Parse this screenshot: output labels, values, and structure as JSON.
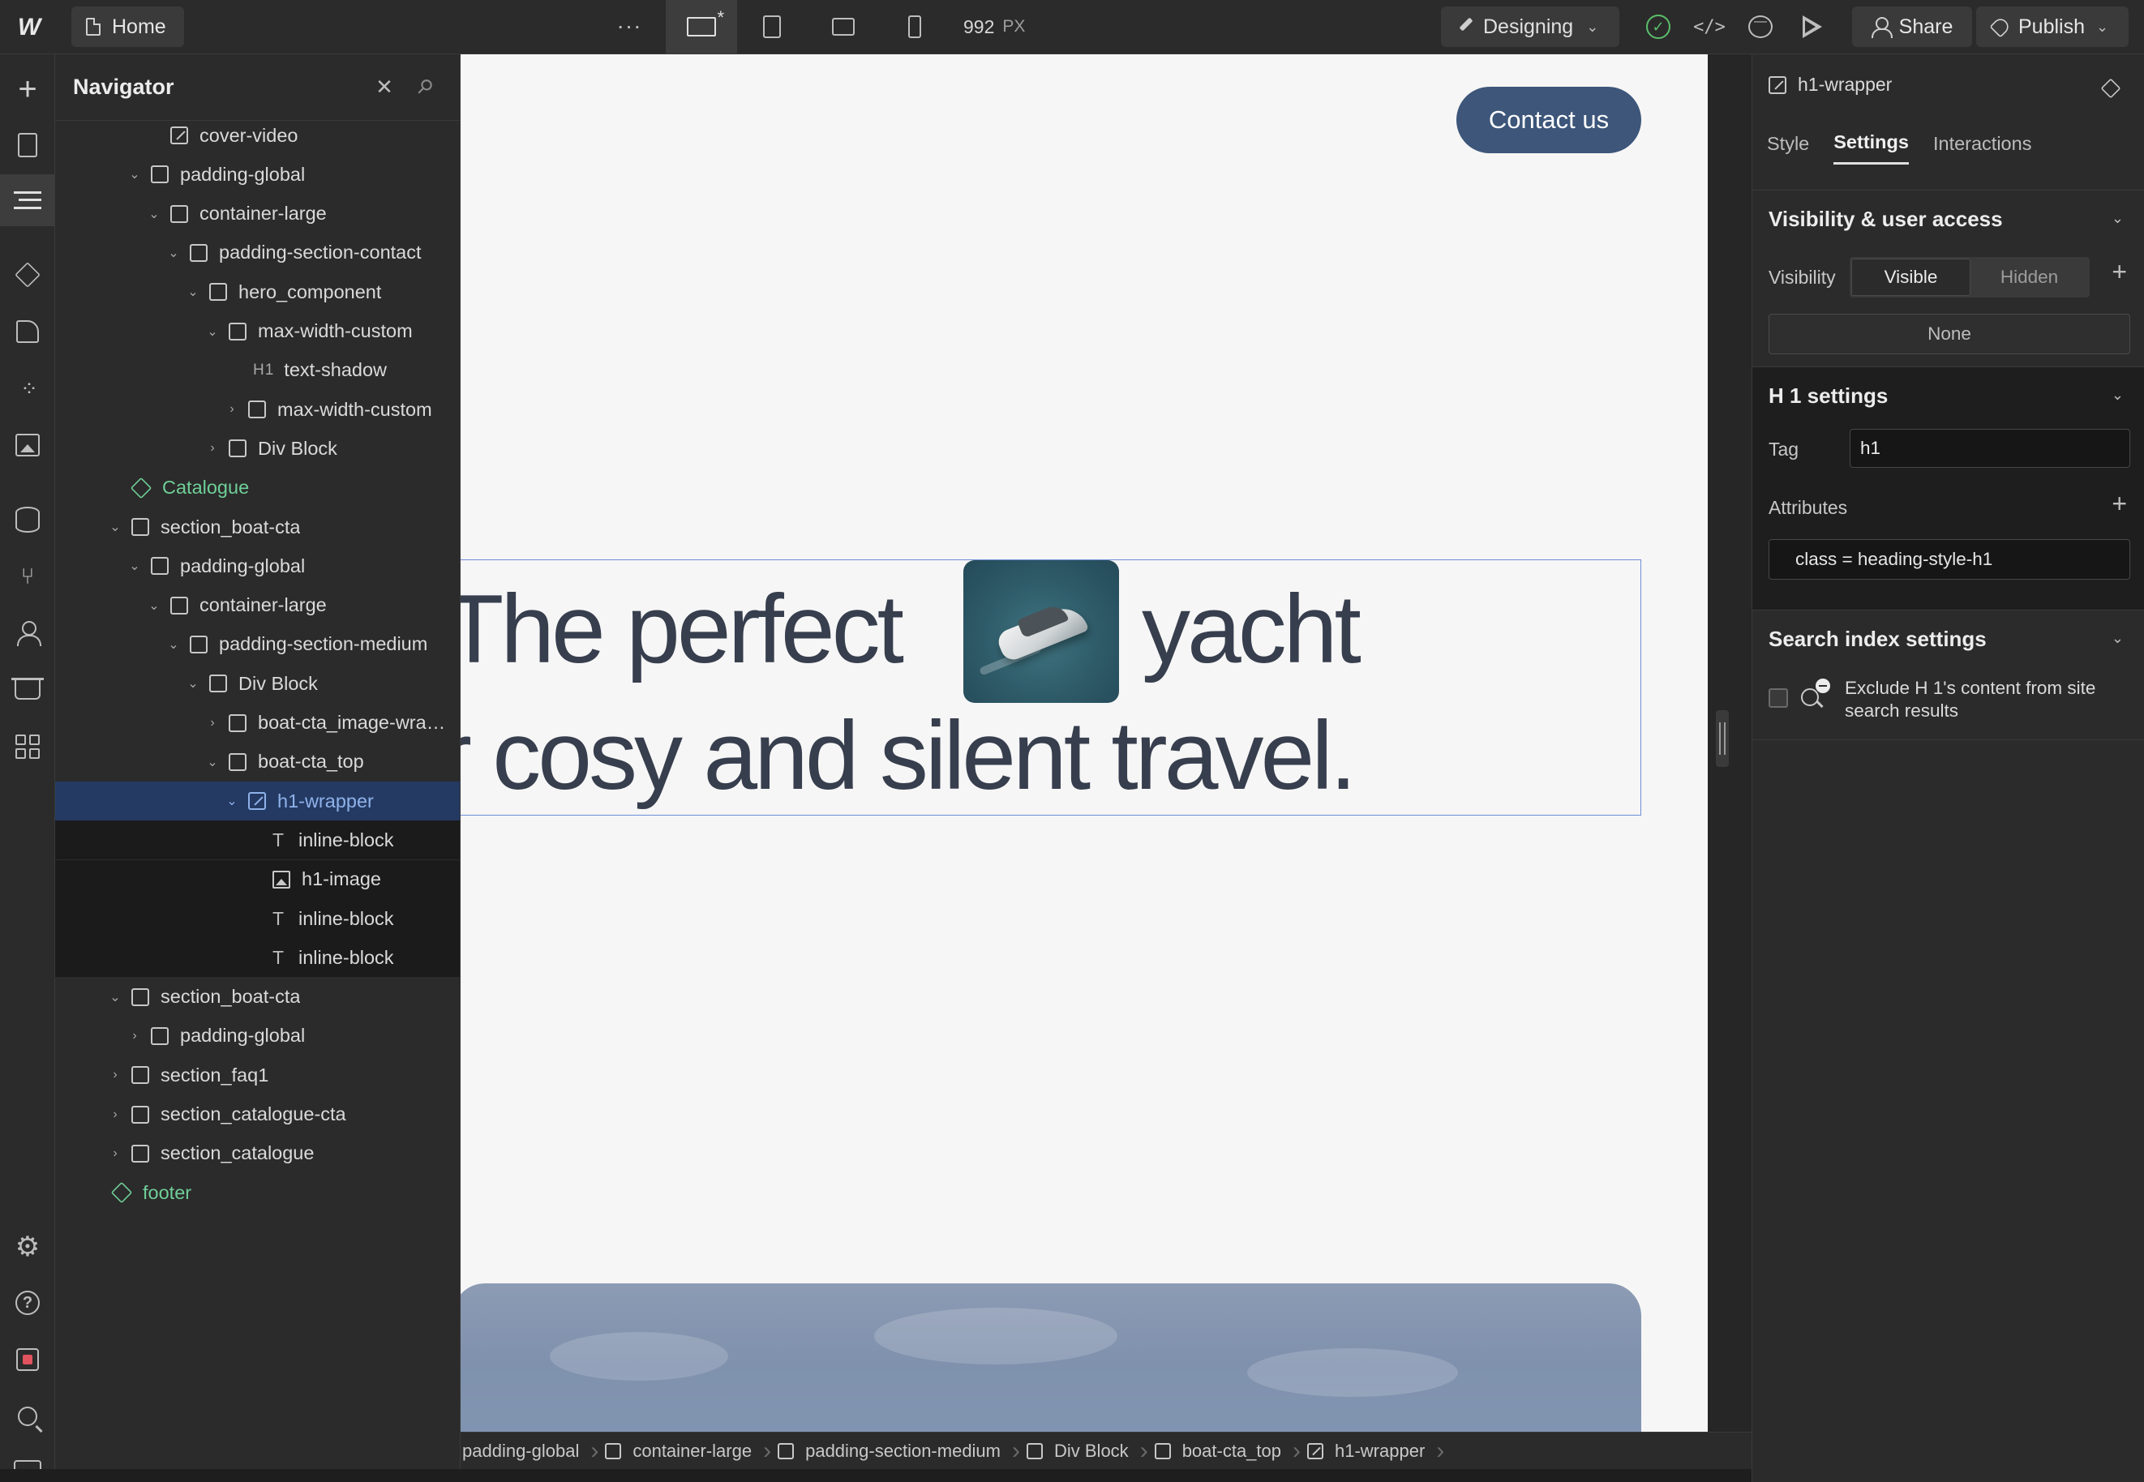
{
  "topbar": {
    "home_label": "Home",
    "more_label": "···",
    "canvas_width": "992",
    "canvas_unit": "PX",
    "mode_label": "Designing",
    "share_label": "Share",
    "publish_label": "Publish",
    "code_label": "</>"
  },
  "navigator": {
    "title": "Navigator",
    "rows": [
      {
        "label": "cover-video",
        "icon": "edit-box",
        "arrow": ""
      },
      {
        "label": "padding-global",
        "icon": "box",
        "arrow": "⌄"
      },
      {
        "label": "container-large",
        "icon": "box",
        "arrow": "⌄"
      },
      {
        "label": "padding-section-contact",
        "icon": "box",
        "arrow": "⌄"
      },
      {
        "label": "hero_component",
        "icon": "box",
        "arrow": "⌄"
      },
      {
        "label": "max-width-custom",
        "icon": "box",
        "arrow": "⌄"
      },
      {
        "label": "text-shadow",
        "icon": "h1",
        "arrow": "",
        "tag": "H1"
      },
      {
        "label": "max-width-custom",
        "icon": "box",
        "arrow": "›"
      },
      {
        "label": "Div Block",
        "icon": "box",
        "arrow": "›"
      },
      {
        "label": "Catalogue",
        "icon": "component",
        "arrow": ""
      },
      {
        "label": "section_boat-cta",
        "icon": "box",
        "arrow": "⌄"
      },
      {
        "label": "padding-global",
        "icon": "box",
        "arrow": "⌄"
      },
      {
        "label": "container-large",
        "icon": "box",
        "arrow": "⌄"
      },
      {
        "label": "padding-section-medium",
        "icon": "box",
        "arrow": "⌄"
      },
      {
        "label": "Div Block",
        "icon": "box",
        "arrow": "⌄"
      },
      {
        "label": "boat-cta_image-wrap...",
        "icon": "box",
        "arrow": "›"
      },
      {
        "label": "boat-cta_top",
        "icon": "box",
        "arrow": "⌄"
      },
      {
        "label": "h1-wrapper",
        "icon": "edit-box",
        "arrow": "⌄",
        "selected": true
      },
      {
        "label": "inline-block",
        "icon": "text",
        "arrow": "",
        "child": true
      },
      {
        "label": "h1-image",
        "icon": "image",
        "arrow": "",
        "child": true
      },
      {
        "label": "inline-block",
        "icon": "text",
        "arrow": "",
        "child": true
      },
      {
        "label": "inline-block",
        "icon": "text",
        "arrow": "",
        "child": true
      },
      {
        "label": "section_boat-cta",
        "icon": "box",
        "arrow": "⌄"
      },
      {
        "label": "padding-global",
        "icon": "box",
        "arrow": "›"
      },
      {
        "label": "section_faq1",
        "icon": "box",
        "arrow": "›"
      },
      {
        "label": "section_catalogue-cta",
        "icon": "box",
        "arrow": "›"
      },
      {
        "label": "section_catalogue",
        "icon": "box",
        "arrow": "›"
      },
      {
        "label": "footer",
        "icon": "component",
        "arrow": ""
      }
    ]
  },
  "canvas": {
    "contact_label": "Contact us",
    "heading_line1_part1": "The perfect",
    "heading_line1_part2": "yacht",
    "heading_line2": "r cosy and silent travel."
  },
  "breadcrumb": [
    {
      "label": "padding-global",
      "icon": "none"
    },
    {
      "label": "container-large",
      "icon": "box"
    },
    {
      "label": "padding-section-medium",
      "icon": "box"
    },
    {
      "label": "Div Block",
      "icon": "box"
    },
    {
      "label": "boat-cta_top",
      "icon": "box"
    },
    {
      "label": "h1-wrapper",
      "icon": "edit-box"
    }
  ],
  "rightpanel": {
    "element_name": "h1-wrapper",
    "tabs": [
      "Style",
      "Settings",
      "Interactions"
    ],
    "active_tab": "Settings",
    "visibility": {
      "title": "Visibility & user access",
      "label": "Visibility",
      "options": [
        "Visible",
        "Hidden"
      ],
      "selected": "Visible",
      "condition": "None"
    },
    "h1_settings": {
      "title": "H 1 settings",
      "tag_label": "Tag",
      "tag_value": "h1",
      "attributes_label": "Attributes",
      "attribute_value": "class = heading-style-h1"
    },
    "search_index": {
      "title": "Search index settings",
      "exclude_label": "Exclude H 1's content from site search results"
    }
  },
  "colors": {
    "accent": "#3d567a",
    "selection": "#243a63",
    "component_green": "#6fcf97",
    "heading_text": "#373e4d"
  }
}
